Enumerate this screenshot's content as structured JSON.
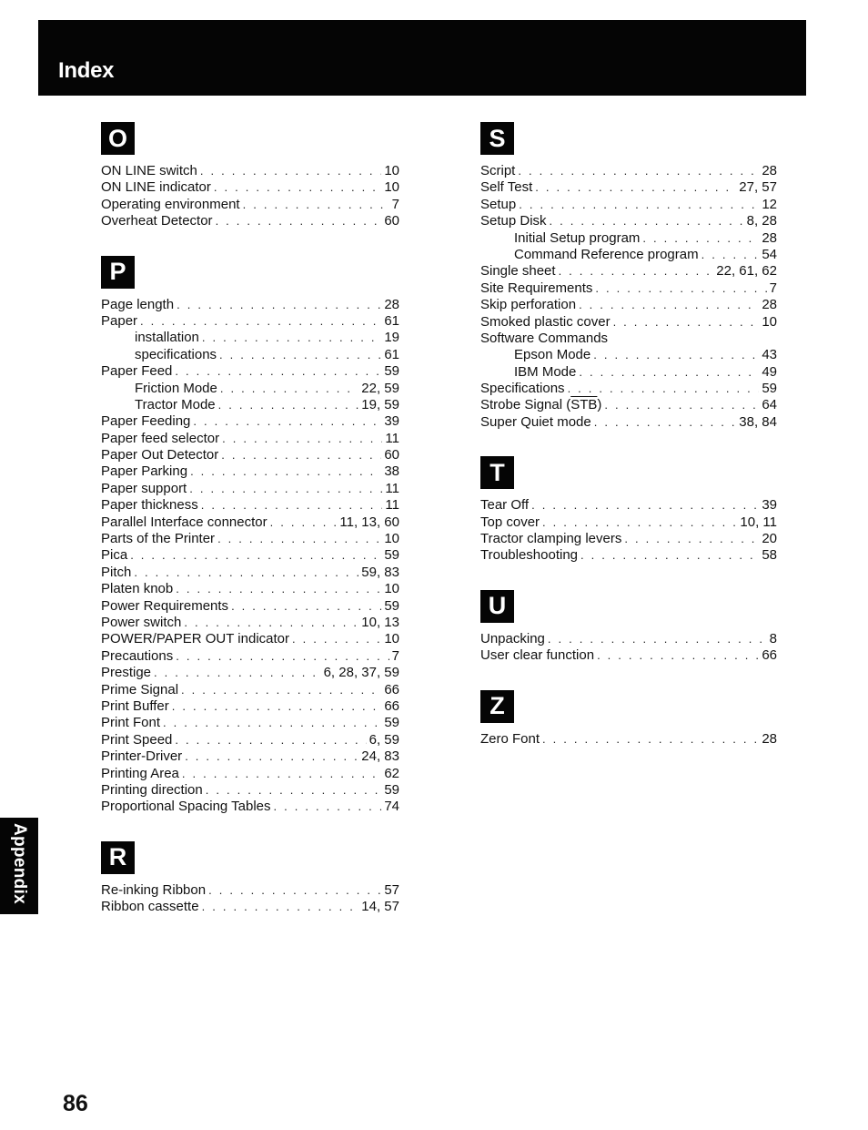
{
  "header": {
    "title": "Index"
  },
  "side_tab": {
    "label": "Appendix"
  },
  "page_number": "86",
  "columns": [
    {
      "sections": [
        {
          "letter": "O",
          "entries": [
            {
              "term": "ON LINE switch",
              "pages": "10",
              "sub": false
            },
            {
              "term": "ON LINE indicator",
              "pages": "10",
              "sub": false
            },
            {
              "term": "Operating environment",
              "pages": "7",
              "sub": false
            },
            {
              "term": "Overheat Detector",
              "pages": "60",
              "sub": false
            }
          ]
        },
        {
          "letter": "P",
          "entries": [
            {
              "term": "Page length",
              "pages": "28",
              "sub": false
            },
            {
              "term": "Paper",
              "pages": "61",
              "sub": false
            },
            {
              "term": "installation",
              "pages": "19",
              "sub": true
            },
            {
              "term": "specifications",
              "pages": "61",
              "sub": true
            },
            {
              "term": "Paper Feed",
              "pages": "59",
              "sub": false
            },
            {
              "term": "Friction Mode",
              "pages": "22, 59",
              "sub": true
            },
            {
              "term": "Tractor Mode",
              "pages": "19, 59",
              "sub": true
            },
            {
              "term": "Paper Feeding",
              "pages": "39",
              "sub": false
            },
            {
              "term": "Paper feed selector",
              "pages": "11",
              "sub": false
            },
            {
              "term": "Paper Out Detector",
              "pages": "60",
              "sub": false
            },
            {
              "term": "Paper Parking",
              "pages": "38",
              "sub": false
            },
            {
              "term": "Paper support",
              "pages": "11",
              "sub": false
            },
            {
              "term": "Paper thickness",
              "pages": "11",
              "sub": false
            },
            {
              "term": "Parallel Interface connector",
              "pages": "11, 13, 60",
              "sub": false
            },
            {
              "term": "Parts of the Printer",
              "pages": "10",
              "sub": false
            },
            {
              "term": "Pica",
              "pages": "59",
              "sub": false
            },
            {
              "term": "Pitch",
              "pages": "59, 83",
              "sub": false
            },
            {
              "term": "Platen knob",
              "pages": "10",
              "sub": false
            },
            {
              "term": "Power Requirements",
              "pages": "59",
              "sub": false
            },
            {
              "term": "Power switch",
              "pages": "10, 13",
              "sub": false
            },
            {
              "term": "POWER/PAPER OUT indicator",
              "pages": "10",
              "sub": false
            },
            {
              "term": "Precautions",
              "pages": "7",
              "sub": false
            },
            {
              "term": "Prestige",
              "pages": "6, 28, 37, 59",
              "sub": false
            },
            {
              "term": "Prime Signal",
              "pages": "66",
              "sub": false
            },
            {
              "term": "Print Buffer",
              "pages": "66",
              "sub": false
            },
            {
              "term": "Print Font",
              "pages": "59",
              "sub": false
            },
            {
              "term": "Print Speed",
              "pages": "6, 59",
              "sub": false
            },
            {
              "term": "Printer-Driver",
              "pages": "24, 83",
              "sub": false
            },
            {
              "term": "Printing Area",
              "pages": "62",
              "sub": false
            },
            {
              "term": "Printing direction",
              "pages": "59",
              "sub": false
            },
            {
              "term": "Proportional Spacing Tables",
              "pages": "74",
              "sub": false
            }
          ]
        },
        {
          "letter": "R",
          "entries": [
            {
              "term": "Re-inking Ribbon",
              "pages": "57",
              "sub": false
            },
            {
              "term": "Ribbon cassette",
              "pages": "14, 57",
              "sub": false
            }
          ]
        }
      ]
    },
    {
      "sections": [
        {
          "letter": "S",
          "entries": [
            {
              "term": "Script",
              "pages": "28",
              "sub": false
            },
            {
              "term": "Self Test",
              "pages": "27, 57",
              "sub": false
            },
            {
              "term": "Setup",
              "pages": "12",
              "sub": false
            },
            {
              "term": "Setup Disk",
              "pages": "8, 28",
              "sub": false
            },
            {
              "term": "Initial Setup program",
              "pages": "28",
              "sub": true
            },
            {
              "term": "Command Reference program",
              "pages": "54",
              "sub": true
            },
            {
              "term": "Single sheet",
              "pages": "22, 61, 62",
              "sub": false
            },
            {
              "term": "Site Requirements",
              "pages": "7",
              "sub": false
            },
            {
              "term": "Skip perforation",
              "pages": "28",
              "sub": false
            },
            {
              "term": "Smoked plastic cover",
              "pages": "10",
              "sub": false
            },
            {
              "term": "Software Commands",
              "pages": "",
              "sub": false
            },
            {
              "term": "Epson Mode",
              "pages": "43",
              "sub": true
            },
            {
              "term": "IBM Mode",
              "pages": "49",
              "sub": true
            },
            {
              "term": "Specifications",
              "pages": "59",
              "sub": false
            },
            {
              "term": "Strobe Signal (STB)",
              "pages": "64",
              "sub": false
            },
            {
              "term": "Super Quiet mode",
              "pages": "38, 84",
              "sub": false
            }
          ]
        },
        {
          "letter": "T",
          "entries": [
            {
              "term": "Tear Off",
              "pages": "39",
              "sub": false
            },
            {
              "term": "Top cover",
              "pages": "10, 11",
              "sub": false
            },
            {
              "term": "Tractor clamping levers",
              "pages": "20",
              "sub": false
            },
            {
              "term": "Troubleshooting",
              "pages": "58",
              "sub": false
            }
          ]
        },
        {
          "letter": "U",
          "entries": [
            {
              "term": "Unpacking",
              "pages": "8",
              "sub": false
            },
            {
              "term": "User clear function",
              "pages": "66",
              "sub": false
            }
          ]
        },
        {
          "letter": "Z",
          "entries": [
            {
              "term": "Zero Font",
              "pages": "28",
              "sub": false
            }
          ]
        }
      ]
    }
  ]
}
